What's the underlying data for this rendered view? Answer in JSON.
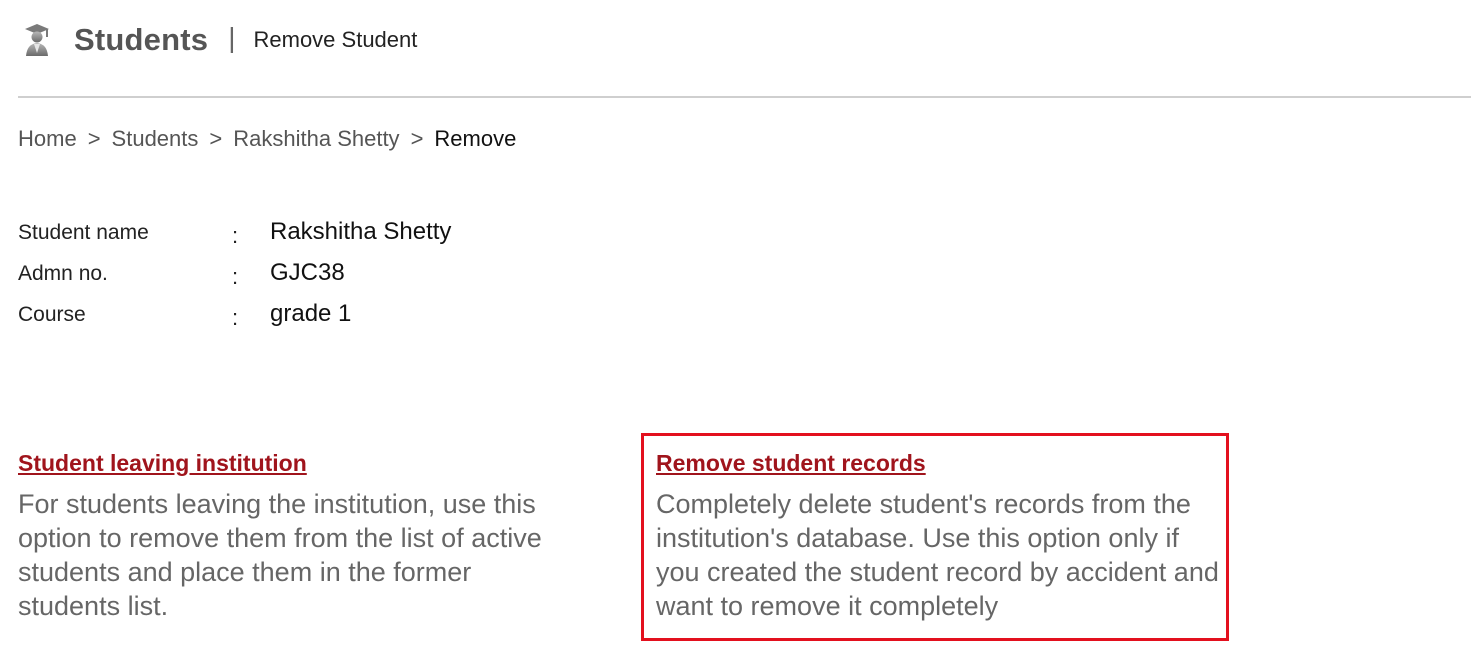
{
  "header": {
    "icon": "student-graduate-icon",
    "title": "Students",
    "separator": "|",
    "subtitle": "Remove Student"
  },
  "breadcrumb": {
    "items": [
      "Home",
      "Students",
      "Rakshitha Shetty"
    ],
    "separator": ">",
    "current": "Remove"
  },
  "student": {
    "rows": [
      {
        "label": "Student name",
        "colon": ":",
        "value": "Rakshitha Shetty"
      },
      {
        "label": "Admn no.",
        "colon": ":",
        "value": "GJC38"
      },
      {
        "label": "Course",
        "colon": ":",
        "value": "grade 1"
      }
    ]
  },
  "options": {
    "leaving": {
      "title": "Student leaving institution",
      "description": "For students leaving the institution, use this option to remove them from the list of active students and place them in the former students list."
    },
    "remove": {
      "title": "Remove student records",
      "description": "Completely delete student's records from the institution's database. Use this option only if you created the student record by accident and want to remove it completely"
    }
  },
  "colors": {
    "link": "#a0141c",
    "highlight_border": "#e3101e",
    "muted_text": "#666666"
  }
}
